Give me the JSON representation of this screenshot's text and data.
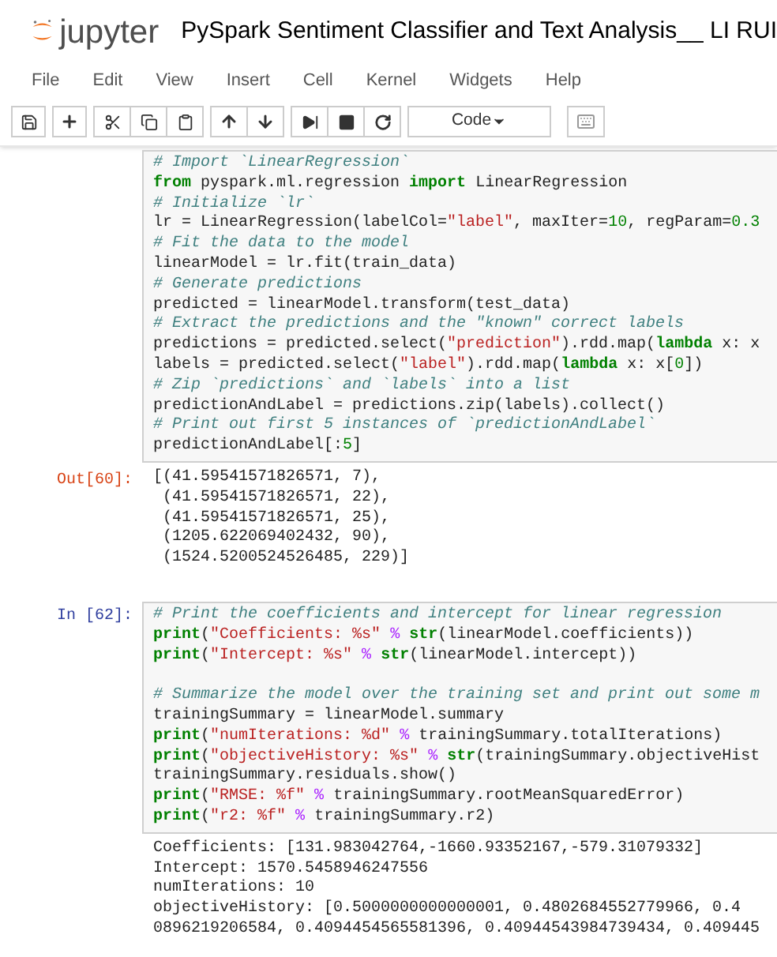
{
  "header": {
    "logo_text": "jupyter",
    "title": "PySpark Sentiment Classifier and Text Analysis__ LI RUI"
  },
  "menu": [
    "File",
    "Edit",
    "View",
    "Insert",
    "Cell",
    "Kernel",
    "Widgets",
    "Help"
  ],
  "toolbar": {
    "cell_type": "Code"
  },
  "cells": [
    {
      "kind": "input",
      "blocks": [
        [
          [
            {
              "kind": "comment",
              "text": "# Import `LinearRegression`"
            }
          ],
          [
            {
              "kind": "keyword",
              "text": "from"
            },
            {
              "kind": "plain",
              "text": " pyspark.ml.regression "
            },
            {
              "kind": "keyword",
              "text": "import"
            },
            {
              "kind": "plain",
              "text": " LinearRegression"
            }
          ],
          [
            {
              "kind": "comment",
              "text": "# Initialize `lr`"
            }
          ],
          [
            {
              "kind": "plain",
              "text": "lr = LinearRegression(labelCol="
            },
            {
              "kind": "string",
              "text": "\"label\""
            },
            {
              "kind": "plain",
              "text": ", maxIter="
            },
            {
              "kind": "number",
              "text": "10"
            },
            {
              "kind": "plain",
              "text": ", regParam="
            },
            {
              "kind": "number",
              "text": "0.3"
            }
          ],
          [
            {
              "kind": "comment",
              "text": "# Fit the data to the model"
            }
          ],
          [
            {
              "kind": "plain",
              "text": "linearModel = lr.fit(train_data)"
            }
          ],
          [
            {
              "kind": "comment",
              "text": "# Generate predictions"
            }
          ],
          [
            {
              "kind": "plain",
              "text": "predicted = linearModel.transform(test_data)"
            }
          ],
          [
            {
              "kind": "comment",
              "text": "# Extract the predictions and the \"known\" correct labels"
            }
          ],
          [
            {
              "kind": "plain",
              "text": "predictions = predicted.select("
            },
            {
              "kind": "string",
              "text": "\"prediction\""
            },
            {
              "kind": "plain",
              "text": ").rdd.map("
            },
            {
              "kind": "keyword",
              "text": "lambda"
            },
            {
              "kind": "plain",
              "text": " x: x"
            }
          ],
          [
            {
              "kind": "plain",
              "text": "labels = predicted.select("
            },
            {
              "kind": "string",
              "text": "\"label\""
            },
            {
              "kind": "plain",
              "text": ").rdd.map("
            },
            {
              "kind": "keyword",
              "text": "lambda"
            },
            {
              "kind": "plain",
              "text": " x: x["
            },
            {
              "kind": "number",
              "text": "0"
            },
            {
              "kind": "plain",
              "text": "])"
            }
          ],
          [
            {
              "kind": "comment",
              "text": "# Zip `predictions` and `labels` into a list"
            }
          ],
          [
            {
              "kind": "plain",
              "text": "predictionAndLabel = predictions.zip(labels).collect()"
            }
          ],
          [
            {
              "kind": "comment",
              "text": "# Print out first 5 instances of `predictionAndLabel`"
            }
          ],
          [
            {
              "kind": "plain",
              "text": "predictionAndLabel[:"
            },
            {
              "kind": "number",
              "text": "5"
            },
            {
              "kind": "plain",
              "text": "]"
            }
          ]
        ]
      ]
    },
    {
      "kind": "result",
      "prompt": "Out[60]:",
      "lines": [
        "[(41.59541571826571, 7),",
        " (41.59541571826571, 22),",
        " (41.59541571826571, 25),",
        " (1205.622069402432, 90),",
        " (1524.5200524526485, 229)]"
      ]
    },
    {
      "kind": "input",
      "prompt": "In [62]:",
      "blocks": [
        [
          [
            {
              "kind": "comment",
              "text": "# Print the coefficients and intercept for linear regression"
            }
          ],
          [
            {
              "kind": "keyword",
              "text": "print"
            },
            {
              "kind": "plain",
              "text": "("
            },
            {
              "kind": "string",
              "text": "\"Coefficients: %s\""
            },
            {
              "kind": "operator",
              "text": " % "
            },
            {
              "kind": "keyword",
              "text": "str"
            },
            {
              "kind": "plain",
              "text": "(linearModel.coefficients))"
            }
          ],
          [
            {
              "kind": "keyword",
              "text": "print"
            },
            {
              "kind": "plain",
              "text": "("
            },
            {
              "kind": "string",
              "text": "\"Intercept: %s\""
            },
            {
              "kind": "operator",
              "text": " % "
            },
            {
              "kind": "keyword",
              "text": "str"
            },
            {
              "kind": "plain",
              "text": "(linearModel.intercept))"
            }
          ]
        ],
        [
          [
            {
              "kind": "comment",
              "text": "# Summarize the model over the training set and print out some m"
            }
          ],
          [
            {
              "kind": "plain",
              "text": "trainingSummary = linearModel.summary"
            }
          ],
          [
            {
              "kind": "keyword",
              "text": "print"
            },
            {
              "kind": "plain",
              "text": "("
            },
            {
              "kind": "string",
              "text": "\"numIterations: %d\""
            },
            {
              "kind": "operator",
              "text": " % "
            },
            {
              "kind": "plain",
              "text": "trainingSummary.totalIterations)"
            }
          ],
          [
            {
              "kind": "keyword",
              "text": "print"
            },
            {
              "kind": "plain",
              "text": "("
            },
            {
              "kind": "string",
              "text": "\"objectiveHistory: %s\""
            },
            {
              "kind": "operator",
              "text": " % "
            },
            {
              "kind": "keyword",
              "text": "str"
            },
            {
              "kind": "plain",
              "text": "(trainingSummary.objectiveHist"
            }
          ],
          [
            {
              "kind": "plain",
              "text": "trainingSummary.residuals.show()"
            }
          ],
          [
            {
              "kind": "keyword",
              "text": "print"
            },
            {
              "kind": "plain",
              "text": "("
            },
            {
              "kind": "string",
              "text": "\"RMSE: %f\""
            },
            {
              "kind": "operator",
              "text": " % "
            },
            {
              "kind": "plain",
              "text": "trainingSummary.rootMeanSquaredError)"
            }
          ],
          [
            {
              "kind": "keyword",
              "text": "print"
            },
            {
              "kind": "plain",
              "text": "("
            },
            {
              "kind": "string",
              "text": "\"r2: %f\""
            },
            {
              "kind": "operator",
              "text": " % "
            },
            {
              "kind": "plain",
              "text": "trainingSummary.r2)"
            }
          ]
        ]
      ]
    },
    {
      "kind": "stream",
      "lines": [
        "Coefficients: [131.983042764,-1660.93352167,-579.31079332]",
        "Intercept: 1570.5458946247556",
        "numIterations: 10",
        "objectiveHistory: [0.5000000000000001, 0.4802684552779966, 0.4",
        "0896219206584, 0.4094454565581396, 0.40944543984739434, 0.409445"
      ]
    }
  ]
}
